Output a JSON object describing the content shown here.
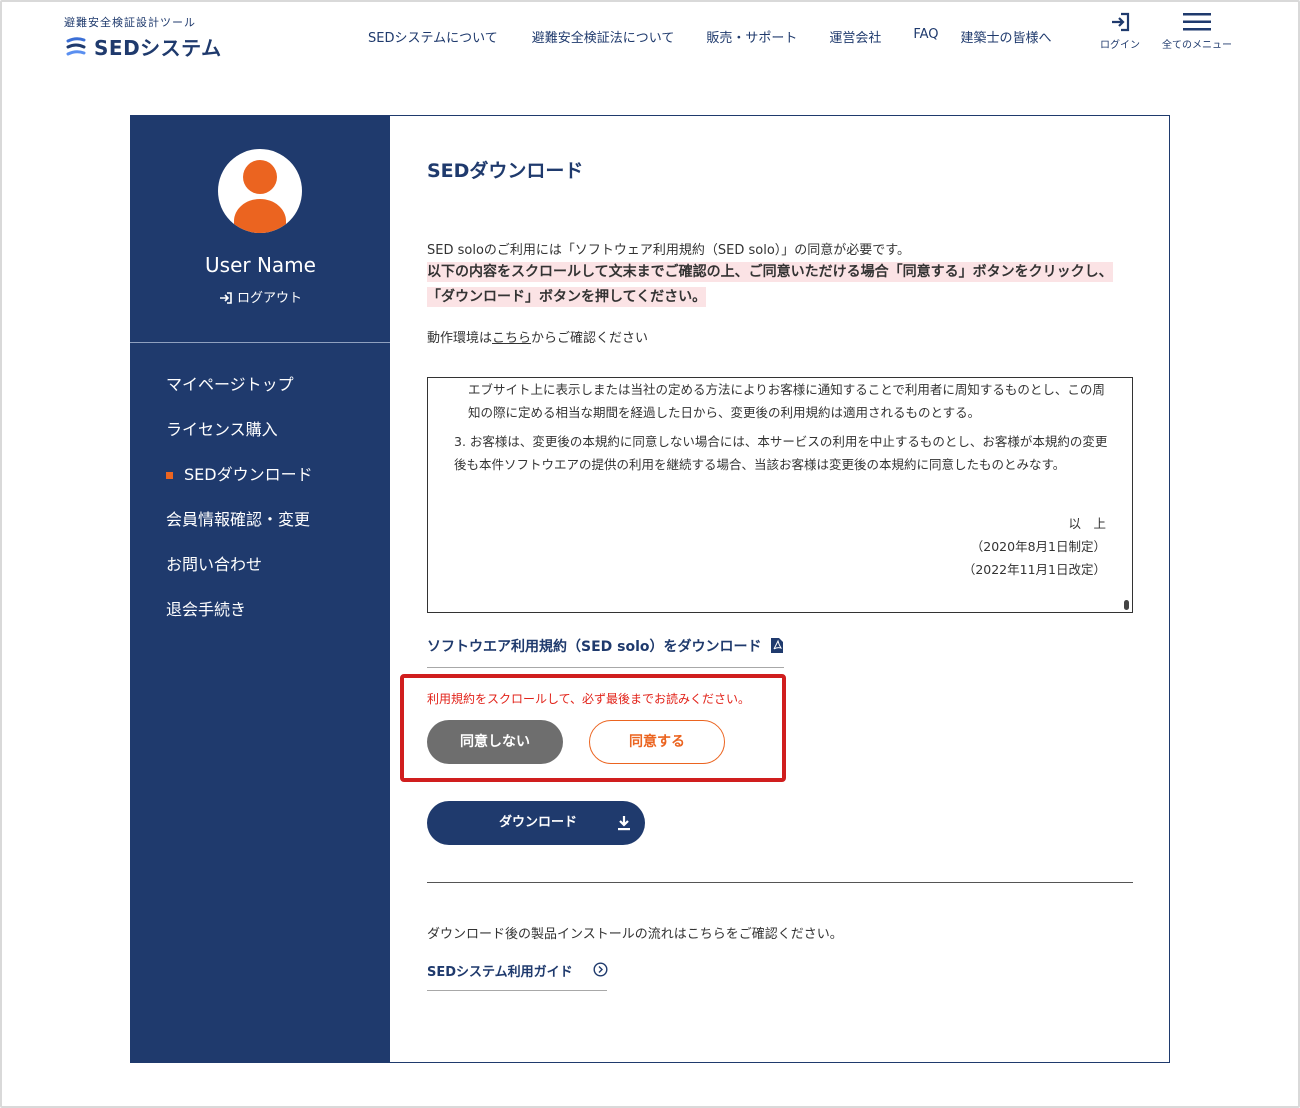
{
  "header": {
    "logo_sub": "避難安全検証設計ツール",
    "logo_text": "SEDシステム",
    "nav": [
      {
        "label": "SEDシステムについて"
      },
      {
        "label": "避難安全検証法について"
      },
      {
        "label": "販売・サポート"
      },
      {
        "label": "運営会社"
      },
      {
        "label": "FAQ"
      },
      {
        "label": "建築士の皆様へ"
      }
    ],
    "login_label": "ログイン",
    "menu_label": "全てのメニュー"
  },
  "sidebar": {
    "user_name": "User Name",
    "logout_label": "ログアウト",
    "items": [
      {
        "label": "マイページトップ"
      },
      {
        "label": "ライセンス購入"
      },
      {
        "label": "SEDダウンロード"
      },
      {
        "label": "会員情報確認・変更"
      },
      {
        "label": "お問い合わせ"
      },
      {
        "label": "退会手続き"
      }
    ],
    "active_index": 2
  },
  "main": {
    "title": "SEDダウンロード",
    "intro": "SED soloのご利用には「ソフトウェア利用規約（SED solo）」の同意が必要です。",
    "warning": "以下の内容をスクロールして文末までご確認の上、ご同意いただける場合「同意する」ボタンをクリックし、「ダウンロード」ボタンを押してください。",
    "env_prefix": "動作環境は",
    "env_link": "こちら",
    "env_suffix": "からご確認ください",
    "terms": {
      "para1": "エブサイト上に表示しまたは当社の定める方法によりお客様に通知することで利用者に周知するものとし、この周知の際に定める相当な期間を経過した日から、変更後の利用規約は適用されるものとする。",
      "para2": "3. お客様は、変更後の本規約に同意しない場合には、本サービスの利用を中止するものとし、お客様が本規約の変更後も本件ソフトウエアの提供の利用を継続する場合、当該お客様は変更後の本規約に同意したものとみなす。",
      "end1": "以　上",
      "end2": "（2020年8月1日制定）",
      "end3": "（2022年11月1日改定）"
    },
    "pdf_link": "ソフトウエア利用規約（SED solo）をダウンロード",
    "notice": "利用規約をスクロールして、必ず最後までお読みください。",
    "disagree_label": "同意しない",
    "agree_label": "同意する",
    "download_label": "ダウンロード",
    "after_text": "ダウンロード後の製品インストールの流れはこちらをご確認ください。",
    "guide_link": "SEDシステム利用ガイド"
  },
  "colors": {
    "navy": "#1f3a6d",
    "orange": "#eb6420",
    "red": "#d01e1e",
    "gray_button": "#6e6e6e",
    "highlight": "#fbe3e5"
  }
}
